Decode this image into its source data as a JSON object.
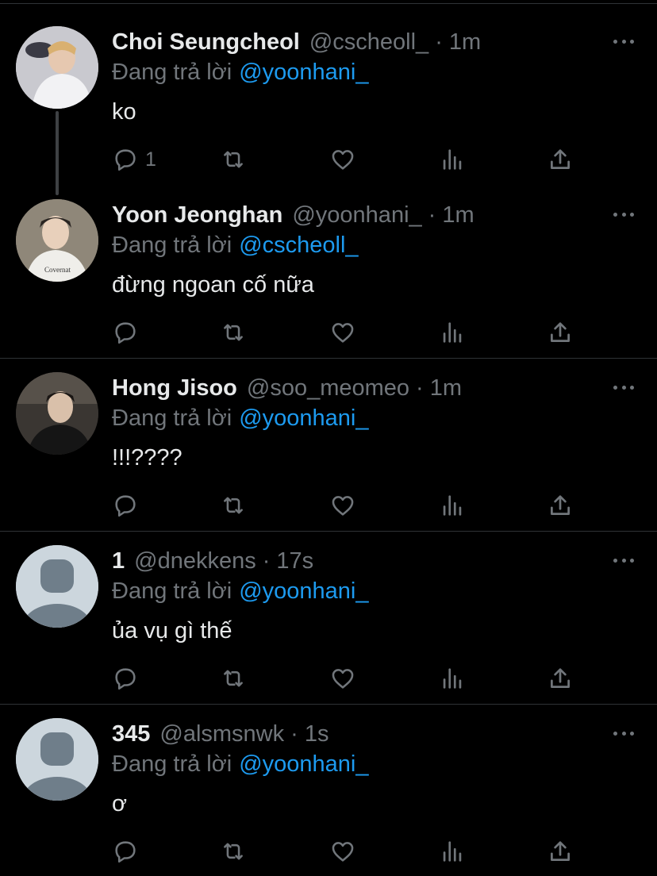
{
  "tweets": [
    {
      "name": "Choi Seungcheol",
      "handle": "@cscheoll_",
      "dot": "·",
      "time": "1m",
      "reply_label": "Đang trả lời",
      "reply_to": "@yoonhani_",
      "text": "ko",
      "reply_count": "1",
      "avatar": {
        "type": "photo",
        "desc": "person-photo",
        "bg": "#d8d8dc"
      }
    },
    {
      "name": "Yoon Jeonghan",
      "handle": "@yoonhani_",
      "dot": "·",
      "time": "1m",
      "reply_label": "Đang trả lời",
      "reply_to": "@cscheoll_",
      "text": "đừng ngoan cố nữa",
      "reply_count": "",
      "avatar": {
        "type": "photo",
        "desc": "person-photo",
        "bg": "#8c8478"
      }
    },
    {
      "name": "Hong Jisoo",
      "handle": "@soo_meomeo",
      "dot": "·",
      "time": "1m",
      "reply_label": "Đang trả lời",
      "reply_to": "@yoonhani_",
      "text": "!!!????",
      "reply_count": "",
      "avatar": {
        "type": "photo",
        "desc": "person-photo",
        "bg": "#2b2b2b"
      }
    },
    {
      "name": "1",
      "handle": "@dnekkens",
      "dot": "·",
      "time": "17s",
      "reply_label": "Đang trả lời",
      "reply_to": "@yoonhani_",
      "text": "ủa vụ gì thế",
      "reply_count": "",
      "avatar": {
        "type": "default",
        "bg": "#ccd6dd",
        "fg": "#6f7e8a"
      }
    },
    {
      "name": "345",
      "handle": "@alsmsnwk",
      "dot": "·",
      "time": "1s",
      "reply_label": "Đang trả lời",
      "reply_to": "@yoonhani_",
      "text": "ơ",
      "reply_count": "",
      "avatar": {
        "type": "default",
        "bg": "#ccd6dd",
        "fg": "#6f7e8a"
      }
    }
  ],
  "icons": {
    "reply": "reply-icon",
    "retweet": "retweet-icon",
    "like": "heart-icon",
    "views": "views-icon",
    "share": "share-icon",
    "more": "more-icon"
  },
  "colors": {
    "background": "#000000",
    "secondary_text": "#71767b",
    "link": "#1d9bf0",
    "divider": "#2f3336"
  }
}
